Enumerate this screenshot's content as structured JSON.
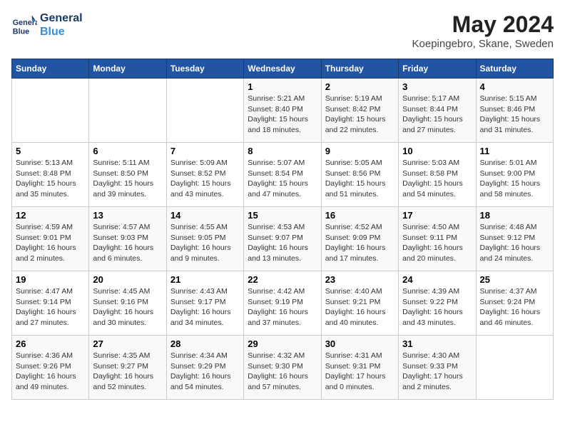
{
  "logo": {
    "line1": "General",
    "line2": "Blue"
  },
  "title": "May 2024",
  "location": "Koepingebro, Skane, Sweden",
  "days_of_week": [
    "Sunday",
    "Monday",
    "Tuesday",
    "Wednesday",
    "Thursday",
    "Friday",
    "Saturday"
  ],
  "weeks": [
    [
      {
        "num": "",
        "info": ""
      },
      {
        "num": "",
        "info": ""
      },
      {
        "num": "",
        "info": ""
      },
      {
        "num": "1",
        "info": "Sunrise: 5:21 AM\nSunset: 8:40 PM\nDaylight: 15 hours\nand 18 minutes."
      },
      {
        "num": "2",
        "info": "Sunrise: 5:19 AM\nSunset: 8:42 PM\nDaylight: 15 hours\nand 22 minutes."
      },
      {
        "num": "3",
        "info": "Sunrise: 5:17 AM\nSunset: 8:44 PM\nDaylight: 15 hours\nand 27 minutes."
      },
      {
        "num": "4",
        "info": "Sunrise: 5:15 AM\nSunset: 8:46 PM\nDaylight: 15 hours\nand 31 minutes."
      }
    ],
    [
      {
        "num": "5",
        "info": "Sunrise: 5:13 AM\nSunset: 8:48 PM\nDaylight: 15 hours\nand 35 minutes."
      },
      {
        "num": "6",
        "info": "Sunrise: 5:11 AM\nSunset: 8:50 PM\nDaylight: 15 hours\nand 39 minutes."
      },
      {
        "num": "7",
        "info": "Sunrise: 5:09 AM\nSunset: 8:52 PM\nDaylight: 15 hours\nand 43 minutes."
      },
      {
        "num": "8",
        "info": "Sunrise: 5:07 AM\nSunset: 8:54 PM\nDaylight: 15 hours\nand 47 minutes."
      },
      {
        "num": "9",
        "info": "Sunrise: 5:05 AM\nSunset: 8:56 PM\nDaylight: 15 hours\nand 51 minutes."
      },
      {
        "num": "10",
        "info": "Sunrise: 5:03 AM\nSunset: 8:58 PM\nDaylight: 15 hours\nand 54 minutes."
      },
      {
        "num": "11",
        "info": "Sunrise: 5:01 AM\nSunset: 9:00 PM\nDaylight: 15 hours\nand 58 minutes."
      }
    ],
    [
      {
        "num": "12",
        "info": "Sunrise: 4:59 AM\nSunset: 9:01 PM\nDaylight: 16 hours\nand 2 minutes."
      },
      {
        "num": "13",
        "info": "Sunrise: 4:57 AM\nSunset: 9:03 PM\nDaylight: 16 hours\nand 6 minutes."
      },
      {
        "num": "14",
        "info": "Sunrise: 4:55 AM\nSunset: 9:05 PM\nDaylight: 16 hours\nand 9 minutes."
      },
      {
        "num": "15",
        "info": "Sunrise: 4:53 AM\nSunset: 9:07 PM\nDaylight: 16 hours\nand 13 minutes."
      },
      {
        "num": "16",
        "info": "Sunrise: 4:52 AM\nSunset: 9:09 PM\nDaylight: 16 hours\nand 17 minutes."
      },
      {
        "num": "17",
        "info": "Sunrise: 4:50 AM\nSunset: 9:11 PM\nDaylight: 16 hours\nand 20 minutes."
      },
      {
        "num": "18",
        "info": "Sunrise: 4:48 AM\nSunset: 9:12 PM\nDaylight: 16 hours\nand 24 minutes."
      }
    ],
    [
      {
        "num": "19",
        "info": "Sunrise: 4:47 AM\nSunset: 9:14 PM\nDaylight: 16 hours\nand 27 minutes."
      },
      {
        "num": "20",
        "info": "Sunrise: 4:45 AM\nSunset: 9:16 PM\nDaylight: 16 hours\nand 30 minutes."
      },
      {
        "num": "21",
        "info": "Sunrise: 4:43 AM\nSunset: 9:17 PM\nDaylight: 16 hours\nand 34 minutes."
      },
      {
        "num": "22",
        "info": "Sunrise: 4:42 AM\nSunset: 9:19 PM\nDaylight: 16 hours\nand 37 minutes."
      },
      {
        "num": "23",
        "info": "Sunrise: 4:40 AM\nSunset: 9:21 PM\nDaylight: 16 hours\nand 40 minutes."
      },
      {
        "num": "24",
        "info": "Sunrise: 4:39 AM\nSunset: 9:22 PM\nDaylight: 16 hours\nand 43 minutes."
      },
      {
        "num": "25",
        "info": "Sunrise: 4:37 AM\nSunset: 9:24 PM\nDaylight: 16 hours\nand 46 minutes."
      }
    ],
    [
      {
        "num": "26",
        "info": "Sunrise: 4:36 AM\nSunset: 9:26 PM\nDaylight: 16 hours\nand 49 minutes."
      },
      {
        "num": "27",
        "info": "Sunrise: 4:35 AM\nSunset: 9:27 PM\nDaylight: 16 hours\nand 52 minutes."
      },
      {
        "num": "28",
        "info": "Sunrise: 4:34 AM\nSunset: 9:29 PM\nDaylight: 16 hours\nand 54 minutes."
      },
      {
        "num": "29",
        "info": "Sunrise: 4:32 AM\nSunset: 9:30 PM\nDaylight: 16 hours\nand 57 minutes."
      },
      {
        "num": "30",
        "info": "Sunrise: 4:31 AM\nSunset: 9:31 PM\nDaylight: 17 hours\nand 0 minutes."
      },
      {
        "num": "31",
        "info": "Sunrise: 4:30 AM\nSunset: 9:33 PM\nDaylight: 17 hours\nand 2 minutes."
      },
      {
        "num": "",
        "info": ""
      }
    ]
  ]
}
